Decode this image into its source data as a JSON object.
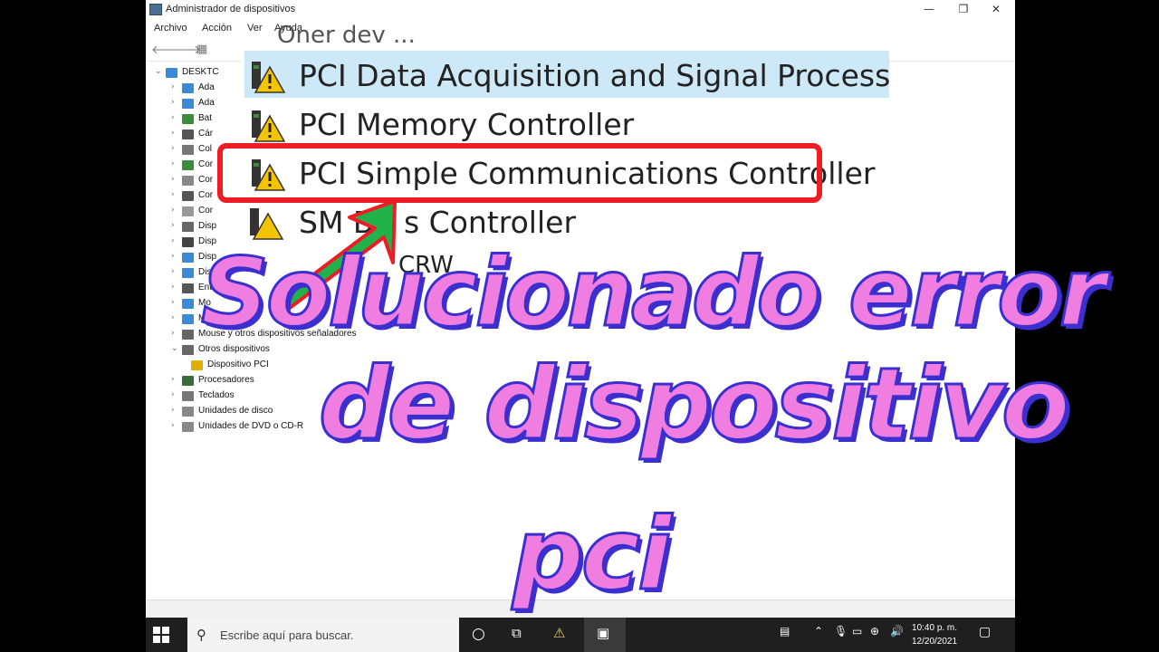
{
  "window": {
    "title": "Administrador de dispositivos",
    "minimize": "—",
    "restore": "❐",
    "close": "✕"
  },
  "menu": [
    "Archivo",
    "Acción",
    "Ver",
    "Ayuda"
  ],
  "toolbar": {
    "back": "🡐",
    "forward": "🡒",
    "grid": "▦"
  },
  "tree": {
    "root": "DESKTC",
    "items": [
      {
        "label": "Ada",
        "icon": "monitor-icon",
        "color": "#3a8ad6"
      },
      {
        "label": "Ada",
        "icon": "monitor-icon",
        "color": "#3a8ad6"
      },
      {
        "label": "Bat",
        "icon": "battery-icon",
        "color": "#3c8c3c"
      },
      {
        "label": "Cár",
        "icon": "camera-icon",
        "color": "#555555"
      },
      {
        "label": "Col",
        "icon": "printer-icon",
        "color": "#777777"
      },
      {
        "label": "Cor",
        "icon": "controller-icon",
        "color": "#3c8c3c"
      },
      {
        "label": "Cor",
        "icon": "controller-icon",
        "color": "#888888"
      },
      {
        "label": "Cor",
        "icon": "usb-icon",
        "color": "#555555"
      },
      {
        "label": "Cor",
        "icon": "audio-icon",
        "color": "#999999"
      },
      {
        "label": "Disp",
        "icon": "device-icon",
        "color": "#666666"
      },
      {
        "label": "Disp",
        "icon": "device-icon",
        "color": "#444444"
      },
      {
        "label": "Disp",
        "icon": "device-icon",
        "color": "#3a8ad6"
      },
      {
        "label": "Disp",
        "icon": "device-icon",
        "color": "#3a8ad6"
      },
      {
        "label": "Ent",
        "icon": "device-icon",
        "color": "#555555"
      },
      {
        "label": "Mo",
        "icon": "monitor-icon",
        "color": "#3a8ad6"
      },
      {
        "label": "Mo",
        "icon": "monitor-icon",
        "color": "#3a8ad6"
      },
      {
        "label": "Mouse y otros dispositivos señaladores",
        "icon": "mouse-icon",
        "color": "#666666"
      },
      {
        "label": "Otros dispositivos",
        "icon": "other-devices-icon",
        "color": "#666666"
      },
      {
        "label": "Dispositivo PCI",
        "icon": "warning-device-icon",
        "color": "#e0b000"
      },
      {
        "label": "Procesadores",
        "icon": "cpu-icon",
        "color": "#3c6c3c"
      },
      {
        "label": "Teclados",
        "icon": "keyboard-icon",
        "color": "#777777"
      },
      {
        "label": "Unidades de disco",
        "icon": "disk-icon",
        "color": "#888888"
      },
      {
        "label": "Unidades de DVD o CD-R",
        "icon": "dvd-icon",
        "color": "#888888"
      }
    ]
  },
  "zoom": {
    "bg_title": "Oner dev ...",
    "rows": [
      {
        "label": "PCI Data Acquisition and Signal Processing Co",
        "selected": true
      },
      {
        "label": "PCI Memory Controller",
        "selected": false
      },
      {
        "label": "PCI Simple Communications Controller",
        "selected": false
      }
    ],
    "partial": [
      "SM B",
      "s Controller"
    ],
    "partial2": "CRW"
  },
  "overlay": {
    "line1": "Solucionado  error",
    "line2": "de dispositivo",
    "line3": "pci",
    "fill": "#f07ee0",
    "stroke": "#3b2fd0"
  },
  "taskbar": {
    "search_placeholder": "Escribe aquí para buscar.",
    "time": "10:40 p. m.",
    "date": "12/20/2021"
  }
}
